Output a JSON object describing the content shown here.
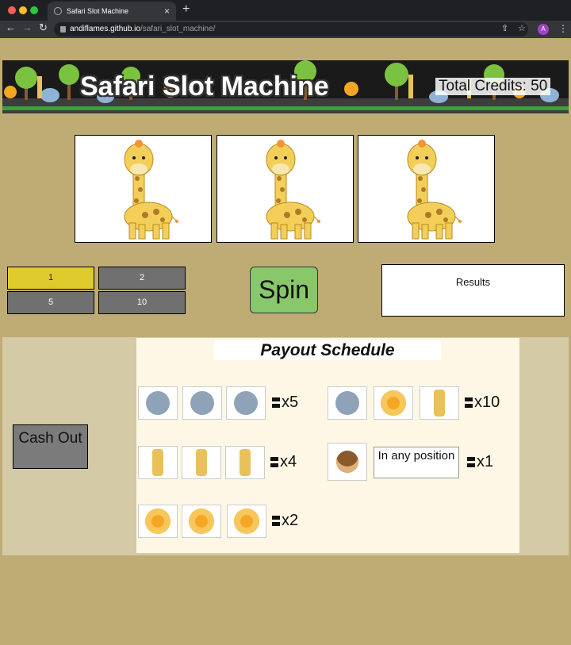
{
  "browser": {
    "tab_title": "Safari Slot Machine",
    "url_host": "andiflames.github.io",
    "url_path": "/safari_slot_machine/",
    "avatar_letter": "A"
  },
  "banner": {
    "title": "Safari Slot Machine",
    "credits_text": "Total Credits: 50"
  },
  "reels": [
    "giraffe",
    "giraffe",
    "giraffe"
  ],
  "bets": [
    {
      "label": "1",
      "active": true
    },
    {
      "label": "2",
      "active": false
    },
    {
      "label": "5",
      "active": false
    },
    {
      "label": "10",
      "active": false
    }
  ],
  "spin_label": "Spin",
  "results_label": "Results",
  "cashout_label": "Cash Out",
  "payout": {
    "title": "Payout Schedule",
    "rows": [
      {
        "symbols": [
          "elephant",
          "elephant",
          "elephant"
        ],
        "multiplier": "x5"
      },
      {
        "symbols": [
          "elephant",
          "lion",
          "giraffe"
        ],
        "multiplier": "x10"
      },
      {
        "symbols": [
          "giraffe",
          "giraffe",
          "giraffe"
        ],
        "multiplier": "x4"
      },
      {
        "symbols": [
          "monkey"
        ],
        "multiplier": "x1",
        "note": "In any position"
      },
      {
        "symbols": [
          "lion",
          "lion",
          "lion"
        ],
        "multiplier": "x2"
      }
    ]
  },
  "colors": {
    "background": "#bfac75",
    "active_bet": "#dfcb2b",
    "inactive_bet": "#707070",
    "spin": "#88c86a"
  }
}
